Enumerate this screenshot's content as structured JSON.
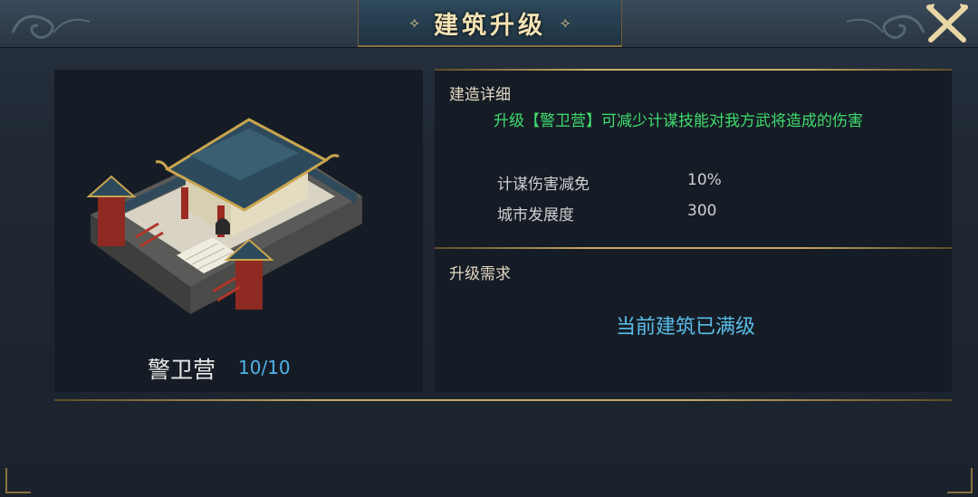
{
  "window": {
    "title": "建筑升级",
    "title_ornament_left": "⟡",
    "title_ornament_right": "⟡"
  },
  "building": {
    "name": "警卫营",
    "level": "10/10"
  },
  "details": {
    "section_title": "建造详细",
    "description": "升级【警卫营】可减少计谋技能对我方武将造成的伤害",
    "stats": [
      {
        "label": "计谋伤害减免",
        "value": "10%"
      },
      {
        "label": "城市发展度",
        "value": "300"
      }
    ]
  },
  "requirements": {
    "section_title": "升级需求",
    "status": "当前建筑已满级"
  },
  "icons": {
    "close": "close-icon",
    "building": "building-illustration"
  },
  "colors": {
    "accent_gold": "#c9a969",
    "desc_green": "#3fdc6e",
    "level_blue": "#4fb3ea",
    "status_blue": "#59bde8"
  }
}
